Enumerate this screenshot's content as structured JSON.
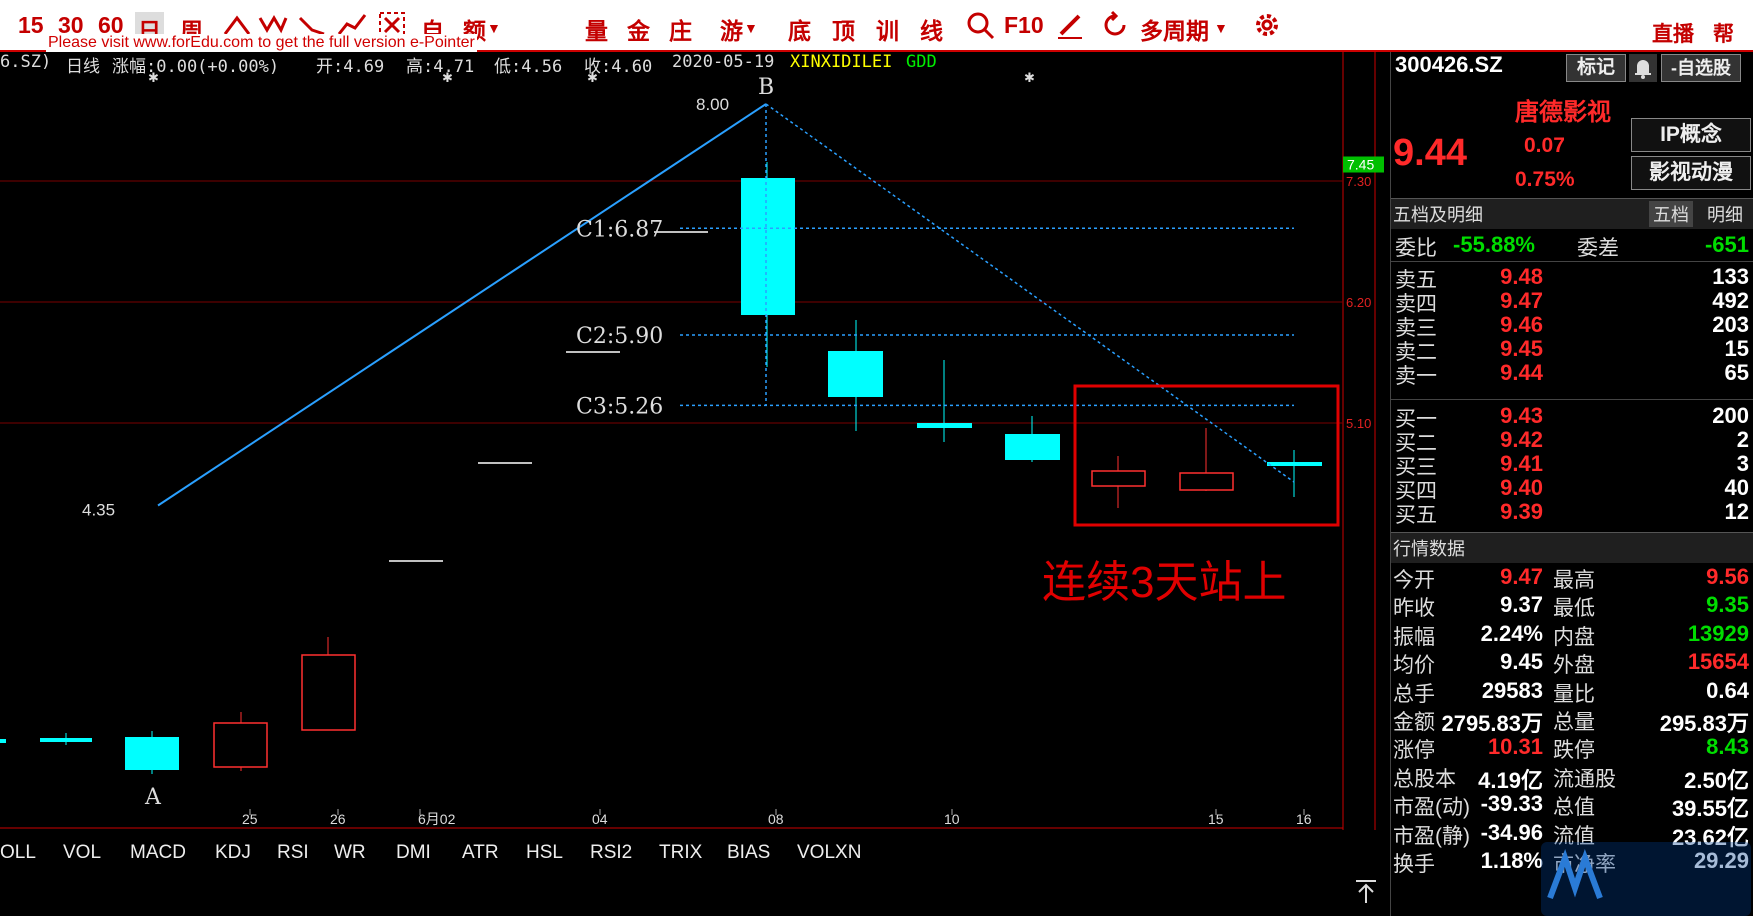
{
  "toolbar": {
    "items": [
      "15",
      "30",
      "60",
      "日",
      "周",
      "自",
      "额",
      "量",
      "金",
      "庄",
      "游",
      "底",
      "顶",
      "训",
      "线",
      "F10",
      "多周期"
    ],
    "right": [
      "直播",
      "帮助"
    ]
  },
  "watermark": "Please visit www.forEdu.com to get the full version e-Pointer",
  "infobar": {
    "code": "6.SZ)",
    "period": "日线",
    "change": "涨幅:0.00(+0.00%)",
    "open": "开:4.69",
    "high": "高:4.71",
    "low": "低:4.56",
    "close": "收:4.60",
    "date": "2020-05-19",
    "ind1": "XINXIDILEI",
    "ind2": "GDD"
  },
  "chart_data": {
    "type": "candlestick",
    "price_axis": [
      {
        "label": "7.45",
        "value": 7.45,
        "highlight": true
      },
      {
        "label": "7.30",
        "value": 7.3
      },
      {
        "label": "6.20",
        "value": 6.2
      },
      {
        "label": "5.10",
        "value": 5.1
      }
    ],
    "x_labels": [
      "25",
      "26",
      "6月02",
      "04",
      "08",
      "10",
      "15",
      "16"
    ],
    "points": [
      {
        "label": "A",
        "price_label": "4.35",
        "value": 4.35
      },
      {
        "label": "B",
        "price_label": "8.00",
        "value": 8.0
      }
    ],
    "levels": [
      {
        "label": "C1:6.87",
        "value": 6.87
      },
      {
        "label": "C2:5.90",
        "value": 5.9
      },
      {
        "label": "C3:5.26",
        "value": 5.26
      }
    ],
    "annotation": "连续3天站上"
  },
  "tabs": [
    "OLL",
    "VOL",
    "MACD",
    "KDJ",
    "RSI",
    "WR",
    "DMI",
    "ATR",
    "HSL",
    "RSI2",
    "TRIX",
    "BIAS",
    "VOLXN"
  ],
  "panel": {
    "code": "300426.SZ",
    "mark_btn": "标记",
    "watch_btn": "-自选股",
    "name": "唐德影视",
    "price": "9.44",
    "change": "0.07",
    "change_pct": "0.75%",
    "tags": [
      "IP概念",
      "影视动漫"
    ],
    "depth_title": "五档及明细",
    "depth_tabs": [
      "五档",
      "明细"
    ],
    "wei": {
      "l1": "委比",
      "v1": "-55.88%",
      "l2": "委差",
      "v2": "-651"
    },
    "asks": [
      {
        "label": "卖五",
        "price": "9.48",
        "vol": "133"
      },
      {
        "label": "卖四",
        "price": "9.47",
        "vol": "492"
      },
      {
        "label": "卖三",
        "price": "9.46",
        "vol": "203"
      },
      {
        "label": "卖二",
        "price": "9.45",
        "vol": "15"
      },
      {
        "label": "卖一",
        "price": "9.44",
        "vol": "65"
      }
    ],
    "bids": [
      {
        "label": "买一",
        "price": "9.43",
        "vol": "200"
      },
      {
        "label": "买二",
        "price": "9.42",
        "vol": "2"
      },
      {
        "label": "买三",
        "price": "9.41",
        "vol": "3"
      },
      {
        "label": "买四",
        "price": "9.40",
        "vol": "40"
      },
      {
        "label": "买五",
        "price": "9.39",
        "vol": "12"
      }
    ],
    "quote_title": "行情数据",
    "quotes": [
      {
        "l1": "今开",
        "v1": "9.47",
        "c1": "red",
        "l2": "最高",
        "v2": "9.56",
        "c2": "red"
      },
      {
        "l1": "昨收",
        "v1": "9.37",
        "c1": "wht",
        "l2": "最低",
        "v2": "9.35",
        "c2": "grn"
      },
      {
        "l1": "振幅",
        "v1": "2.24%",
        "c1": "wht",
        "l2": "内盘",
        "v2": "13929",
        "c2": "grn"
      },
      {
        "l1": "均价",
        "v1": "9.45",
        "c1": "wht",
        "l2": "外盘",
        "v2": "15654",
        "c2": "red"
      },
      {
        "l1": "总手",
        "v1": "29583",
        "c1": "wht",
        "l2": "量比",
        "v2": "0.64",
        "c2": "wht"
      },
      {
        "l1": "金额",
        "v1": "2795.83万",
        "c1": "wht",
        "l2": "总量",
        "v2": "295.83万",
        "c2": "wht"
      },
      {
        "l1": "涨停",
        "v1": "10.31",
        "c1": "red",
        "l2": "跌停",
        "v2": "8.43",
        "c2": "grn"
      },
      {
        "l1": "总股本",
        "v1": "4.19亿",
        "c1": "wht",
        "l2": "流通股",
        "v2": "2.50亿",
        "c2": "wht"
      },
      {
        "l1": "市盈(动)",
        "v1": "-39.33",
        "c1": "wht",
        "l2": "总值",
        "v2": "39.55亿",
        "c2": "wht"
      },
      {
        "l1": "市盈(静)",
        "v1": "-34.96",
        "c1": "wht",
        "l2": "流值",
        "v2": "23.62亿",
        "c2": "wht"
      },
      {
        "l1": "换手",
        "v1": "1.18%",
        "c1": "wht",
        "l2": "市净率",
        "v2": "29.29",
        "c2": "wht"
      }
    ]
  }
}
